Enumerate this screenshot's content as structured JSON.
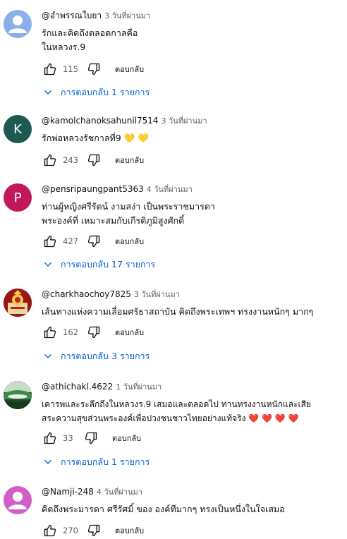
{
  "colors": {
    "link": "#065fd4",
    "secondary": "#606060"
  },
  "comments": [
    {
      "author": "@อำพรรณใบยา",
      "time": "3 วันที่ผ่านมา",
      "text": "รักและคิดถึงตลอดกาลคือ\nในหลวงร.9",
      "likes": "115",
      "reply_label": "ตอบกลับ",
      "replies_label": "การตอบกลับ 1 รายการ",
      "avatar": {
        "type": "default-person-icon",
        "color": "#8ab0ec"
      }
    },
    {
      "author": "@kamolchanoksahunil7514",
      "time": "3 วันที่ผ่านมา",
      "text": "รักพ่อหลวงรัชกาลที่9 💛 💛",
      "likes": "243",
      "reply_label": "ตอบกลับ",
      "avatar": {
        "type": "letter",
        "letter": "K",
        "color": "#1e5a52"
      }
    },
    {
      "author": "@pensripaungpant5363",
      "time": "4 วันที่ผ่านมา",
      "text": "ท่านผู้หญิงศรีรัตน์   งามสง่า   เป็นพระราชมารดา\nพระองค์ที่    เหมาะสมกับเกีรติภูมิสูงศักดิ์",
      "likes": "427",
      "reply_label": "ตอบกลับ",
      "replies_label": "การตอบกลับ 17 รายการ",
      "avatar": {
        "type": "letter",
        "letter": "P",
        "color": "#c2185b"
      }
    },
    {
      "author": "@charkhaochoy7825",
      "time": "3 วันที่ผ่านมา",
      "text": "เส้นทางแห่งความเลื่อมศรัธาสถาบัน คิดถึงพระเทพฯ ทรงงานหนักๆ มากๆ",
      "likes": "162",
      "reply_label": "ตอบกลับ",
      "replies_label": "การตอบกลับ 3 รายการ",
      "avatar": {
        "type": "photo-emblem",
        "color": "#b02020"
      }
    },
    {
      "author": "@athichakl.4622",
      "time": "1 วันที่ผ่านมา",
      "text": "เคารพและระลึกถึงในหลวงร.9 เสมอและตลอดไป ท่านทรงงานหนักและเสีย\nสระความสุขส่วนพระองค์เพื่อปวงชนชาวไทยอย่างแท้จริง ❤️ ❤️ ❤️ ❤️",
      "likes": "33",
      "reply_label": "ตอบกลับ",
      "replies_label": "การตอบกลับ 1 รายการ",
      "avatar": {
        "type": "photo-landscape",
        "color": "#2f6b3a"
      }
    },
    {
      "author": "@Namji-248",
      "time": "4 วันที่ผ่านมา",
      "text": "คิดถึงพระมารดา  ศรีรัศมิ์ ของ องค์ทีมากๆ  ทรงเป็นหนึ่งในใจเสมอ",
      "likes": "270",
      "reply_label": "ตอบกลับ",
      "avatar": {
        "type": "default-person-icon",
        "color": "#d060c8"
      }
    }
  ]
}
